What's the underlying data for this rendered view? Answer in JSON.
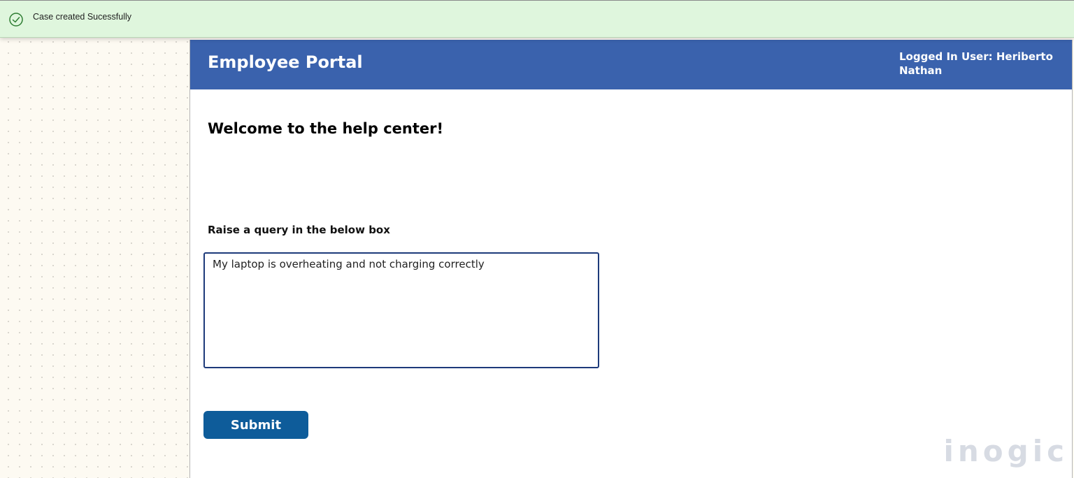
{
  "toast": {
    "message": "Case created Sucessfully",
    "icon": "check-circle-icon",
    "color": "#dff6dd"
  },
  "header": {
    "title": "Employee Portal",
    "user": "Logged In User: Heriberto Nathan",
    "color": "#3a62ad"
  },
  "main": {
    "welcome": "Welcome to the help center!",
    "query_label": "Raise a query in the below box",
    "query_value": "My laptop is overheating and not charging correctly",
    "submit_label": "Submit",
    "submit_color": "#0e5c9a"
  },
  "watermark": "inogic"
}
